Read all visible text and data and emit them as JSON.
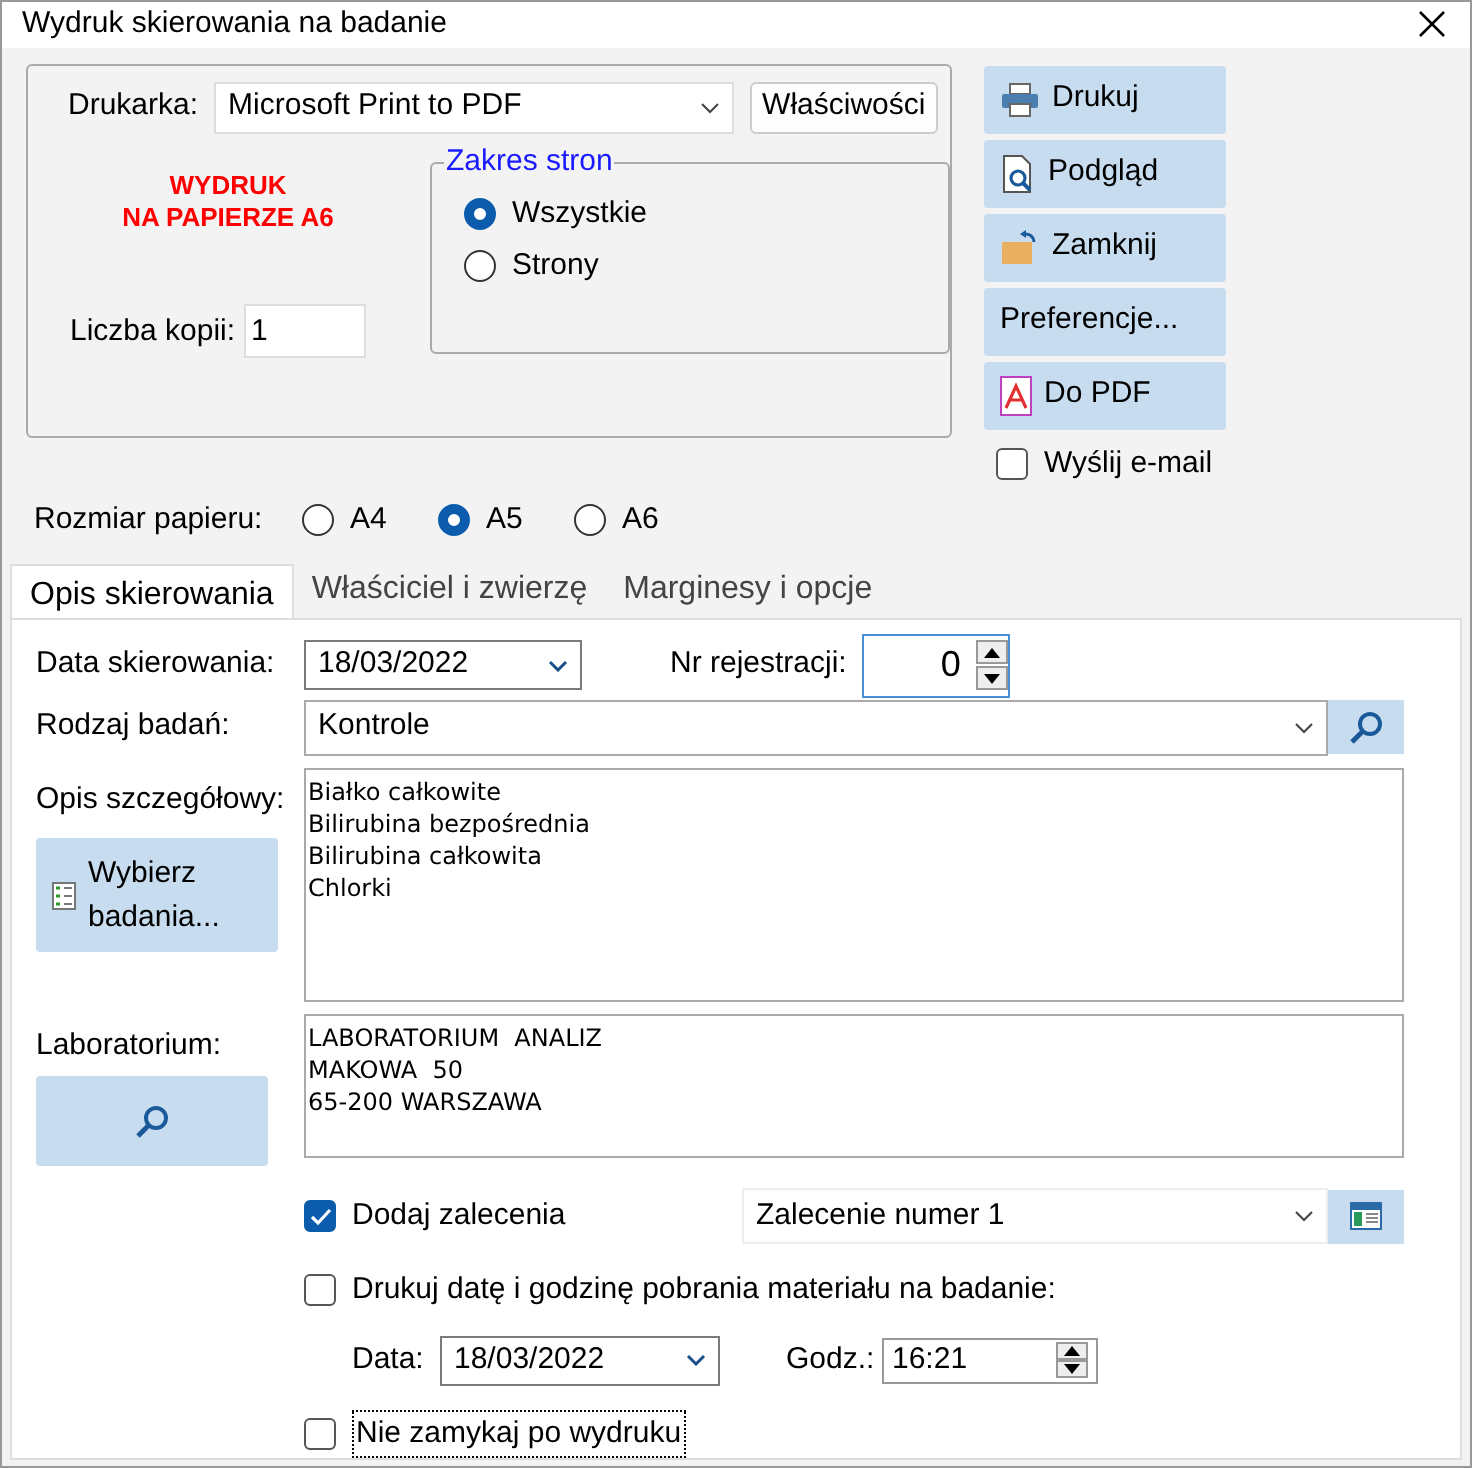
{
  "window": {
    "title": "Wydruk skierowania na badanie"
  },
  "printer": {
    "label": "Drukarka:",
    "value": "Microsoft Print to PDF",
    "properties_button": "Właściwości"
  },
  "notice_lines": [
    "WYDRUK",
    "NA PAPIERZE A6"
  ],
  "copies": {
    "label": "Liczba kopii:",
    "value": "1"
  },
  "page_range": {
    "legend": "Zakres stron",
    "options": [
      {
        "label": "Wszystkie",
        "selected": true
      },
      {
        "label": "Strony",
        "selected": false
      }
    ]
  },
  "action_buttons": [
    {
      "label": "Drukuj",
      "kind": "print"
    },
    {
      "label": "Podgląd",
      "kind": "preview"
    },
    {
      "label": "Zamknij",
      "kind": "close"
    },
    {
      "label": "Preferencje...",
      "kind": "plain"
    },
    {
      "label": "Do PDF",
      "kind": "pdf"
    }
  ],
  "email": {
    "label": "Wyślij e-mail",
    "checked": false
  },
  "paper_size": {
    "label": "Rozmiar papieru:",
    "options": [
      {
        "label": "A4",
        "selected": false
      },
      {
        "label": "A5",
        "selected": true
      },
      {
        "label": "A6",
        "selected": false
      }
    ]
  },
  "tabs": [
    {
      "label": "Opis skierowania",
      "selected": true
    },
    {
      "label": "Właściciel i zwierzę",
      "selected": false
    },
    {
      "label": "Marginesy i opcje",
      "selected": false
    }
  ],
  "referral_date": {
    "label": "Data skierowania:",
    "value": "18/03/2022"
  },
  "registration_no": {
    "label": "Nr rejestracji:",
    "value": "0"
  },
  "exam_type": {
    "label": "Rodzaj badań:",
    "value": "Kontrole"
  },
  "details": {
    "label": "Opis szczegółowy:",
    "button": "Wybierz badania...",
    "lines": [
      "Białko całkowite",
      "Bilirubina bezpośrednia",
      "Bilirubina całkowita",
      "Chlorki"
    ]
  },
  "laboratory": {
    "label": "Laboratorium:",
    "lines": [
      "LABORATORIUM  ANALIZ",
      "MAKOWA  50",
      "65-200 WARSZAWA"
    ]
  },
  "recommendations": {
    "label": "Dodaj zalecenia",
    "checked": true,
    "value": "Zalecenie numer 1"
  },
  "print_sampling": {
    "label": "Drukuj datę i godzinę pobrania materiału na badanie:",
    "checked": false
  },
  "sampling_date": {
    "label": "Data:",
    "value": "18/03/2022"
  },
  "sampling_time": {
    "label": "Godz.:",
    "value": "16:21"
  },
  "keep_open": {
    "label": "Nie zamykaj po wydruku",
    "checked": false
  }
}
